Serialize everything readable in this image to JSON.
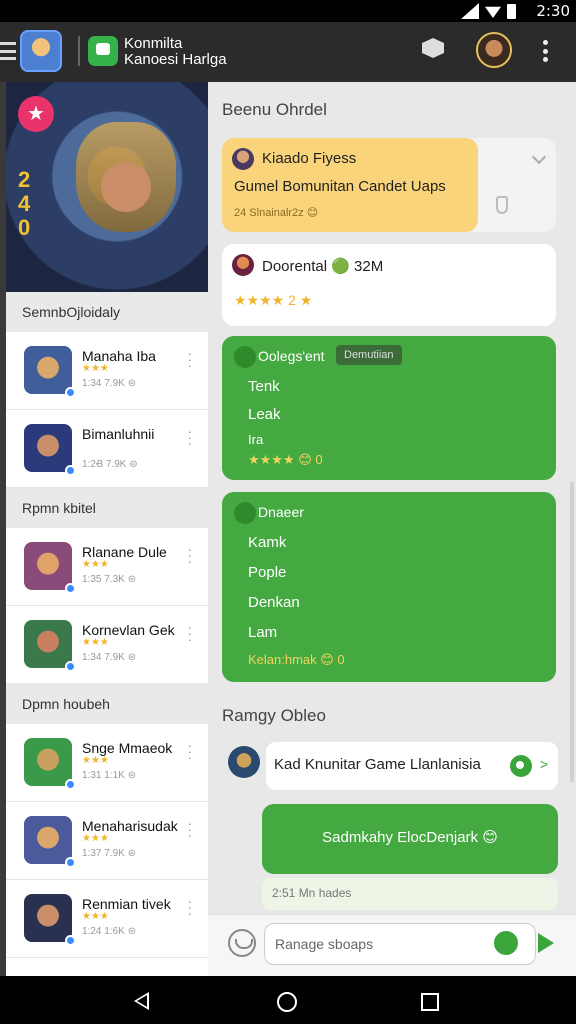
{
  "status_bar": {
    "time": "2:30"
  },
  "app_bar": {
    "title_line1": "Konmilta",
    "title_line2": "Kanoesi Harlga"
  },
  "hero": {
    "badge_symbol": "★",
    "side_text": "240"
  },
  "sidebar": {
    "sections": [
      {
        "header": "SemnbOjloidaly"
      },
      {
        "header": "Rpmn kbitel"
      },
      {
        "header": "Dpmn houbeh"
      }
    ],
    "games": [
      {
        "name": "Manaha Iba",
        "stars": "★★★",
        "meta": "1:34 7.9K ⊜"
      },
      {
        "name": "Bimanluhnii",
        "stars": "",
        "meta": "1:2Ꞗ 7.9K ⊜"
      },
      {
        "name": "Rlanane Dule",
        "stars": "★★★",
        "meta": "1:35 7.3K ⊜"
      },
      {
        "name": "Kornevlan Gek",
        "stars": "★★★",
        "meta": "1:34 7.9K ⊜"
      },
      {
        "name": "Snge Mmaeok",
        "stars": "★★★",
        "meta": "1:31 1:1K ⊜"
      },
      {
        "name": "Menaharisudak",
        "stars": "★★★",
        "meta": "1:37 7.9K ⊜"
      },
      {
        "name": "Renmian tivek",
        "stars": "★★★",
        "meta": "1:24 1:6K ⊜"
      }
    ]
  },
  "chat": {
    "title": "Beenu Ohrdel",
    "pinned": {
      "name": "Kiaado Fiyess",
      "text": "Gumel Bomunitan Candet Uaps",
      "meta": "24 Slnainalr2z 😊"
    },
    "card": {
      "name": "Doorental 🟢 32M",
      "stars": "★★★★ 2 ★"
    },
    "bubble1": {
      "name": "Oolegs'ent",
      "tag": "Demutiian",
      "lines": [
        "Tenk",
        "Leak",
        "Ira"
      ],
      "foot": "★★★★ 😊 0"
    },
    "bubble2": {
      "name": "Dnaeer",
      "lines": [
        "Kamk",
        "Pople",
        "Denkan",
        "Lam"
      ],
      "foot": "Kelan:hmak 😊 0"
    },
    "section_label": "Ramgy Obleo",
    "reply": {
      "text": "Kad Knunitar Game Llanlanisia",
      "chevron": ">"
    },
    "my_bubble": {
      "text": "Sadmkahy ElocDenjark 😊"
    },
    "time_chip": "2:51 Mn hades",
    "composer": {
      "placeholder": "Ranage sboaps"
    }
  },
  "colors": {
    "accent_green": "#43a940",
    "pinned_yellow": "#fad47a",
    "star_gold": "#f0b62b",
    "badge_pink": "#e8336b"
  },
  "icons": [
    "hamburger-icon",
    "chat-logo-icon",
    "cube-icon",
    "kebab-icon",
    "pin-icon",
    "chevron-down-icon",
    "emoji-icon",
    "mic-icon",
    "send-icon",
    "nav-back-icon",
    "nav-home-icon",
    "nav-recent-icon"
  ]
}
